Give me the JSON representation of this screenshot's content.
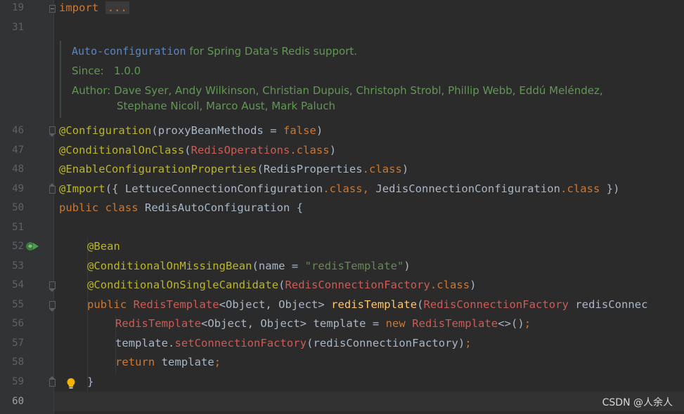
{
  "gutter": {
    "line_numbers": [
      "19",
      "31",
      "46",
      "47",
      "48",
      "49",
      "50",
      "51",
      "52",
      "53",
      "54",
      "55",
      "56",
      "57",
      "58",
      "59",
      "60"
    ]
  },
  "code": {
    "l19_import": "import",
    "l19_folded": "...",
    "doc_link": "Auto-configuration",
    "doc_text": " for Spring Data's Redis support.",
    "doc_since_label": "Since:",
    "doc_since_value": "1.0.0",
    "doc_author_label": "Author:",
    "doc_author_line1": "Dave Syer, Andy Wilkinson, Christian Dupuis, Christoph Strobl, Phillip Webb, Eddú Meléndez,",
    "doc_author_line2": "Stephane Nicoll, Marco Aust, Mark Paluch",
    "l46_an": "@Configuration",
    "l46_a": "(proxyBeanMethods = ",
    "l46_kw": "false",
    "l46_b": ")",
    "l47_an": "@ConditionalOnClass",
    "l47_a": "(",
    "l47_cl": "RedisOperations",
    "l47_kw": ".class",
    "l47_b": ")",
    "l48_an": "@EnableConfigurationProperties",
    "l48_a": "(RedisProperties",
    "l48_kw": ".class",
    "l48_b": ")",
    "l49_an": "@Import",
    "l49_a": "({ LettuceConnectionConfiguration",
    "l49_kw1": ".class,",
    "l49_b": " JedisConnectionConfiguration",
    "l49_kw2": ".class",
    "l49_c": " })",
    "l50_kw": "public class",
    "l50_a": " RedisAutoConfiguration {",
    "l52_an": "@Bean",
    "l53_an": "@ConditionalOnMissingBean",
    "l53_a": "(name = ",
    "l53_st": "\"redisTemplate\"",
    "l53_b": ")",
    "l54_an": "@ConditionalOnSingleCandidate",
    "l54_a": "(",
    "l54_cl": "RedisConnectionFactory",
    "l54_kw": ".class",
    "l54_b": ")",
    "l55_kw": "public",
    "l55_cl1": " RedisTemplate",
    "l55_a": "<Object, Object> ",
    "l55_fn": "redisTemplate",
    "l55_b": "(",
    "l55_cl2": "RedisConnectionFactory",
    "l55_c": " redisConnec",
    "l56_cl1": "RedisTemplate",
    "l56_a": "<Object, Object> template = ",
    "l56_kw": "new",
    "l56_cl2": " RedisTemplate",
    "l56_b": "<>()",
    "l56_semi": ";",
    "l57_a": "template.",
    "l57_mc": "setConnectionFactory",
    "l57_b": "(redisConnectionFactory)",
    "l57_semi": ";",
    "l58_kw": "return",
    "l58_a": " template",
    "l58_semi": ";",
    "l59_a": "}"
  },
  "icons": {
    "run_icon": "bean-run-gutter-icon",
    "bulb_icon": "intention-bulb-icon"
  },
  "watermark": "CSDN @人余人",
  "colors": {
    "background": "#2b2b2b",
    "keyword": "#cc7832",
    "annotation": "#bbb529",
    "string": "#6a8759",
    "doc": "#629755",
    "method": "#ffc66d",
    "error_class": "#cf5b56"
  }
}
